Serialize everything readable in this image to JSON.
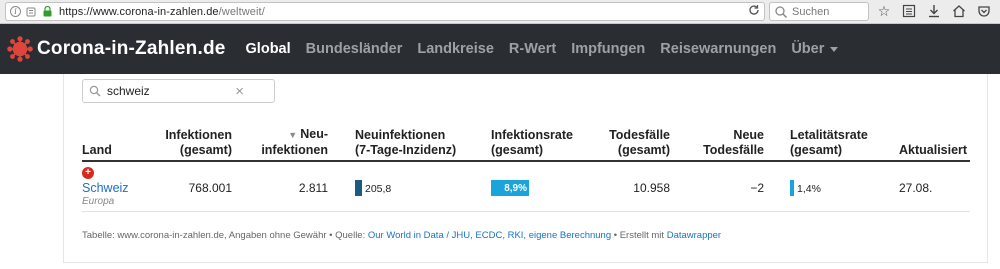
{
  "browser": {
    "url_host": "https://www.corona-in-zahlen.de",
    "url_path": "/weltweit/",
    "search_placeholder": "Suchen"
  },
  "nav": {
    "logo_text": "Corona-in-Zahlen.de",
    "items": [
      "Global",
      "Bundesländer",
      "Landkreise",
      "R-Wert",
      "Impfungen",
      "Reisewarnungen",
      "Über"
    ],
    "active": "Global"
  },
  "filter": {
    "value": "schweiz",
    "clear_icon": "×"
  },
  "table": {
    "headers": {
      "land": "Land",
      "infektionen_l1": "Infektionen",
      "infektionen_l2": "(gesamt)",
      "neu_l1": "Neu-",
      "neu_l2": "infektionen",
      "inzidenz_l1": "Neuinfektionen",
      "inzidenz_l2": "(7-Tage-Inzidenz)",
      "rate_l1": "Infektionsrate",
      "rate_l2": "(gesamt)",
      "tod_l1": "Todesfälle",
      "tod_l2": "(gesamt)",
      "neutod_l1": "Neue",
      "neutod_l2": "Todesfälle",
      "letal_l1": "Letalitätsrate",
      "letal_l2": "(gesamt)",
      "aktualisiert": "Aktualisiert"
    },
    "rows": [
      {
        "flag_icon": "swiss-cross",
        "country": "Schweiz",
        "continent": "Europa",
        "infektionen": "768.001",
        "neuinfektionen": "2.811",
        "inzidenz": "205,8",
        "infektionsrate": "8,9%",
        "todesfaelle": "10.958",
        "neue_todesfaelle": "−2",
        "letalitaetsrate": "1,4%",
        "aktualisiert": "27.08."
      }
    ]
  },
  "footer": {
    "prefix": "Tabelle: www.corona-in-zahlen.de, Angaben ohne Gewähr • Quelle: ",
    "source_links": "Our World in Data / JHU, ECDC, RKI, eigene Berechnung",
    "middle": " • Erstellt mit ",
    "tool_link": "Datawrapper"
  }
}
